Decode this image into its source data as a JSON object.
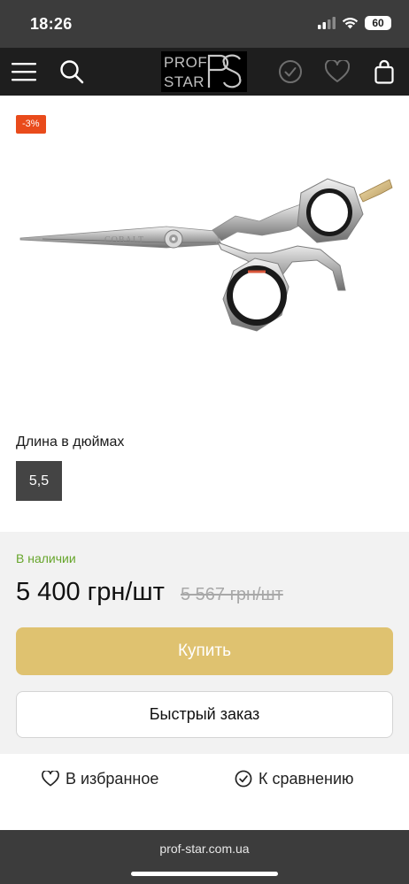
{
  "status_bar": {
    "time": "18:26",
    "battery": "60"
  },
  "header": {
    "logo_line1": "PROF",
    "logo_line2": "STAR",
    "icons": [
      "menu-icon",
      "search-icon",
      "check-circle-icon",
      "heart-icon",
      "shopping-bag-icon"
    ]
  },
  "product": {
    "discount_badge": "-3%",
    "image_label": "COBALT",
    "option_label": "Длина в дюймах",
    "option_value": "5,5"
  },
  "purchase": {
    "stock_status": "В наличии",
    "price_current": "5 400 грн/шт",
    "price_old": "5 567 грн/шт",
    "buy_label": "Купить",
    "quick_order_label": "Быстрый заказ"
  },
  "actions": {
    "favorite_label": "В избранное",
    "compare_label": "К сравнению"
  },
  "browser": {
    "url": "prof-star.com.ua"
  },
  "colors": {
    "accent_gold": "#dfc270",
    "discount_red": "#e94b1b",
    "stock_green": "#66a52b",
    "header_dark": "#1e1e1e"
  }
}
